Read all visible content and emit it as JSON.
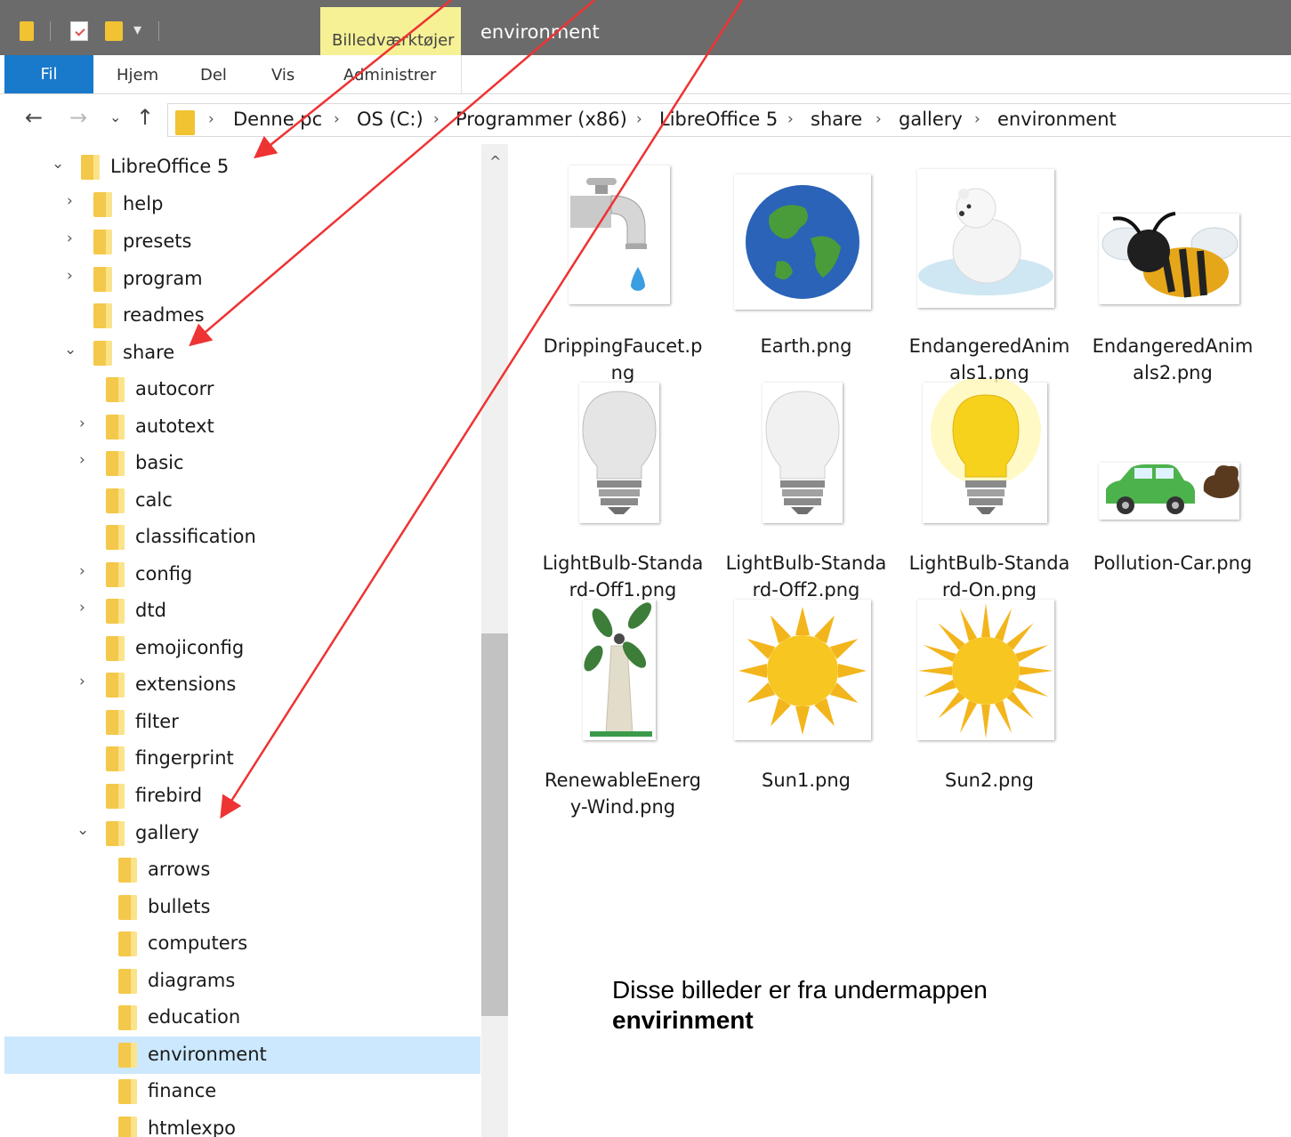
{
  "titlebar": {
    "context_tab": "Billedværktøjer",
    "window_title": "environment"
  },
  "ribbon": {
    "file_tab": "Fil",
    "tabs": [
      "Hjem",
      "Del",
      "Vis"
    ],
    "context_subtab": "Administrer"
  },
  "address": {
    "crumbs": [
      "Denne pc",
      "OS (C:)",
      "Programmer (x86)",
      "LibreOffice 5",
      "share",
      "gallery",
      "environment"
    ]
  },
  "tree": {
    "items": [
      {
        "label": "LibreOffice 5",
        "expanded": true
      },
      {
        "label": "help",
        "expanded": false
      },
      {
        "label": "presets",
        "expanded": false
      },
      {
        "label": "program",
        "expanded": false
      },
      {
        "label": "readmes"
      },
      {
        "label": "share",
        "expanded": true
      },
      {
        "label": "autocorr"
      },
      {
        "label": "autotext",
        "expanded": false
      },
      {
        "label": "basic",
        "expanded": false
      },
      {
        "label": "calc"
      },
      {
        "label": "classification"
      },
      {
        "label": "config",
        "expanded": false
      },
      {
        "label": "dtd",
        "expanded": false
      },
      {
        "label": "emojiconfig"
      },
      {
        "label": "extensions",
        "expanded": false
      },
      {
        "label": "filter"
      },
      {
        "label": "fingerprint"
      },
      {
        "label": "firebird"
      },
      {
        "label": "gallery",
        "expanded": true
      },
      {
        "label": "arrows"
      },
      {
        "label": "bullets"
      },
      {
        "label": "computers"
      },
      {
        "label": "diagrams"
      },
      {
        "label": "education"
      },
      {
        "label": "environment",
        "selected": true
      },
      {
        "label": "finance"
      },
      {
        "label": "htmlexpo"
      }
    ]
  },
  "files": [
    {
      "name": "DrippingFaucet.png",
      "icon": "faucet-icon"
    },
    {
      "name": "Earth.png",
      "icon": "earth-icon"
    },
    {
      "name": "EndangeredAnimals1.png",
      "icon": "polar-bear-icon"
    },
    {
      "name": "EndangeredAnimals2.png",
      "icon": "bee-icon"
    },
    {
      "name": "LightBulb-Standard-Off1.png",
      "icon": "lightbulb-off-icon"
    },
    {
      "name": "LightBulb-Standard-Off2.png",
      "icon": "lightbulb-off-icon"
    },
    {
      "name": "LightBulb-Standard-On.png",
      "icon": "lightbulb-on-icon"
    },
    {
      "name": "Pollution-Car.png",
      "icon": "car-icon"
    },
    {
      "name": "RenewableEnergy-Wind.png",
      "icon": "wind-turbine-icon"
    },
    {
      "name": "Sun1.png",
      "icon": "sun-icon"
    },
    {
      "name": "Sun2.png",
      "icon": "sun-icon"
    }
  ],
  "caption": {
    "line1": "Disse billeder er fra undermappen",
    "line2": "envirinment"
  },
  "colors": {
    "annotation_arrow": "#ee3333",
    "selection": "#cce8ff",
    "file_tab": "#1979ca",
    "context_tab": "#f6f195"
  }
}
